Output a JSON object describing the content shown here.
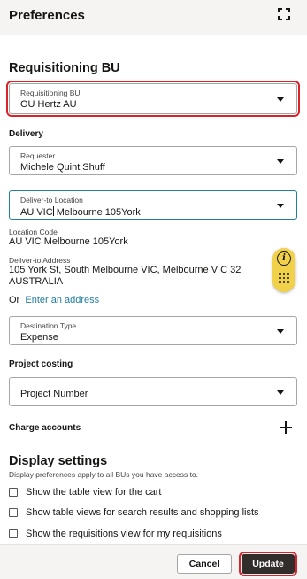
{
  "header": {
    "title": "Preferences",
    "expand_icon": "expand-icon"
  },
  "requisitioning": {
    "section_title": "Requisitioning BU",
    "field_label": "Requisitioning BU",
    "field_value": "OU Hertz AU"
  },
  "delivery": {
    "title": "Delivery",
    "requester_label": "Requester",
    "requester_value": "Michele Quint Shuff",
    "deliver_to_label": "Deliver-to Location",
    "deliver_to_value_before_cursor": "AU VIC",
    "deliver_to_value_after_cursor": " Melbourne 105York",
    "location_code_label": "Location Code",
    "location_code_value": "AU VIC Melbourne 105York",
    "address_label": "Deliver-to Address",
    "address_line1": "105 York St, South Melbourne VIC, Melbourne VIC 32",
    "address_line2": "AUSTRALIA",
    "or_text": "Or",
    "enter_address_link": "Enter an address",
    "destination_type_label": "Destination Type",
    "destination_type_value": "Expense"
  },
  "project_costing": {
    "title": "Project costing",
    "project_number_placeholder": "Project Number"
  },
  "charge_accounts": {
    "title": "Charge accounts",
    "add_icon": "plus-icon"
  },
  "display_settings": {
    "title": "Display settings",
    "description": "Display preferences apply to all BUs you have access to.",
    "options": [
      {
        "label": "Show the table view for the cart",
        "checked": false
      },
      {
        "label": "Show table views for search results and shopping lists",
        "checked": false
      },
      {
        "label": "Show the requisitions view for my requisitions",
        "checked": false
      }
    ]
  },
  "footer": {
    "cancel_label": "Cancel",
    "update_label": "Update"
  },
  "colors": {
    "highlight": "#d9222a",
    "link": "#227e9e",
    "primary_button": "#312d2a",
    "assistant": "#f2d14a"
  }
}
